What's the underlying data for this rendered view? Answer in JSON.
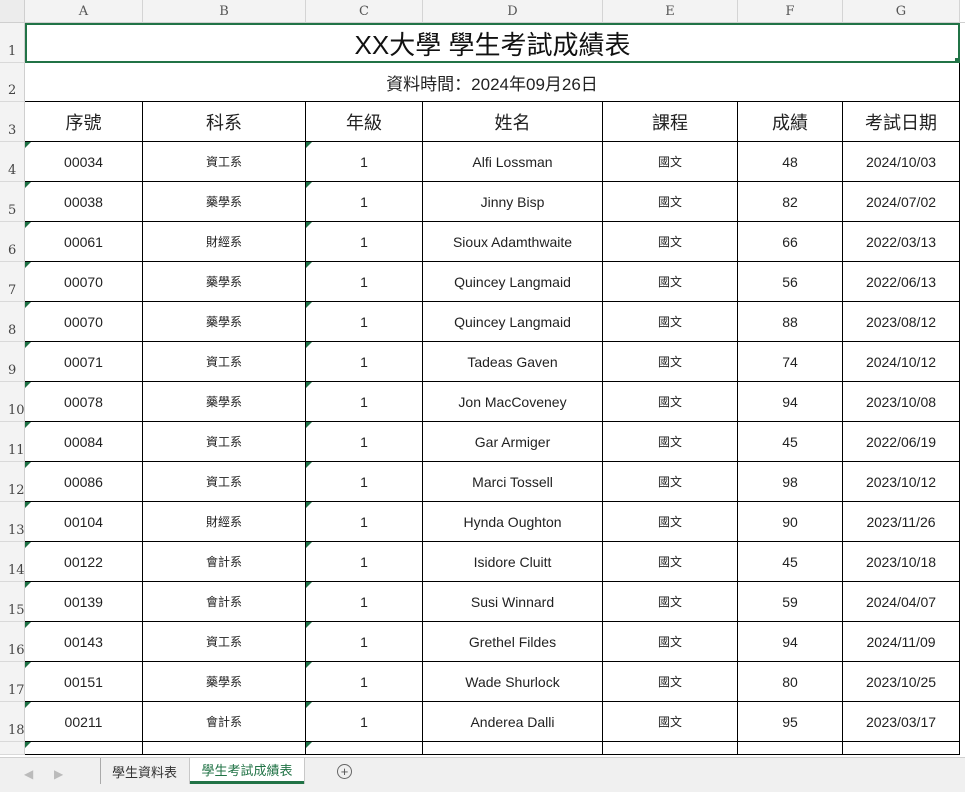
{
  "columns": [
    "A",
    "B",
    "C",
    "D",
    "E",
    "F",
    "G"
  ],
  "rows": [
    "1",
    "2",
    "3",
    "4",
    "5",
    "6",
    "7",
    "8",
    "9",
    "10",
    "11",
    "12",
    "13",
    "14",
    "15",
    "16",
    "17",
    "18"
  ],
  "sheet": {
    "title": "XX大學 學生考試成績表",
    "subtitle": "資料時間：2024年09月26日",
    "headers": [
      "序號",
      "科系",
      "年級",
      "姓名",
      "課程",
      "成績",
      "考試日期"
    ],
    "records": [
      [
        "00034",
        "資工系",
        "1",
        "Alfi Lossman",
        "國文",
        "48",
        "2024/10/03"
      ],
      [
        "00038",
        "藥學系",
        "1",
        "Jinny Bisp",
        "國文",
        "82",
        "2024/07/02"
      ],
      [
        "00061",
        "財經系",
        "1",
        "Sioux Adamthwaite",
        "國文",
        "66",
        "2022/03/13"
      ],
      [
        "00070",
        "藥學系",
        "1",
        "Quincey Langmaid",
        "國文",
        "56",
        "2022/06/13"
      ],
      [
        "00070",
        "藥學系",
        "1",
        "Quincey Langmaid",
        "國文",
        "88",
        "2023/08/12"
      ],
      [
        "00071",
        "資工系",
        "1",
        "Tadeas Gaven",
        "國文",
        "74",
        "2024/10/12"
      ],
      [
        "00078",
        "藥學系",
        "1",
        "Jon MacCoveney",
        "國文",
        "94",
        "2023/10/08"
      ],
      [
        "00084",
        "資工系",
        "1",
        "Gar Armiger",
        "國文",
        "45",
        "2022/06/19"
      ],
      [
        "00086",
        "資工系",
        "1",
        "Marci Tossell",
        "國文",
        "98",
        "2023/10/12"
      ],
      [
        "00104",
        "財經系",
        "1",
        "Hynda Oughton",
        "國文",
        "90",
        "2023/11/26"
      ],
      [
        "00122",
        "會計系",
        "1",
        "Isidore Cluitt",
        "國文",
        "45",
        "2023/10/18"
      ],
      [
        "00139",
        "會計系",
        "1",
        "Susi Winnard",
        "國文",
        "59",
        "2024/04/07"
      ],
      [
        "00143",
        "資工系",
        "1",
        "Grethel Fildes",
        "國文",
        "94",
        "2024/11/09"
      ],
      [
        "00151",
        "藥學系",
        "1",
        "Wade Shurlock",
        "國文",
        "80",
        "2023/10/25"
      ],
      [
        "00211",
        "會計系",
        "1",
        "Anderea Dalli",
        "國文",
        "95",
        "2023/03/17"
      ]
    ]
  },
  "tabs": [
    {
      "label": "學生資料表",
      "active": false
    },
    {
      "label": "學生考試成績表",
      "active": true
    }
  ],
  "colors": {
    "accent": "#217346",
    "flag": "#1e7145"
  }
}
